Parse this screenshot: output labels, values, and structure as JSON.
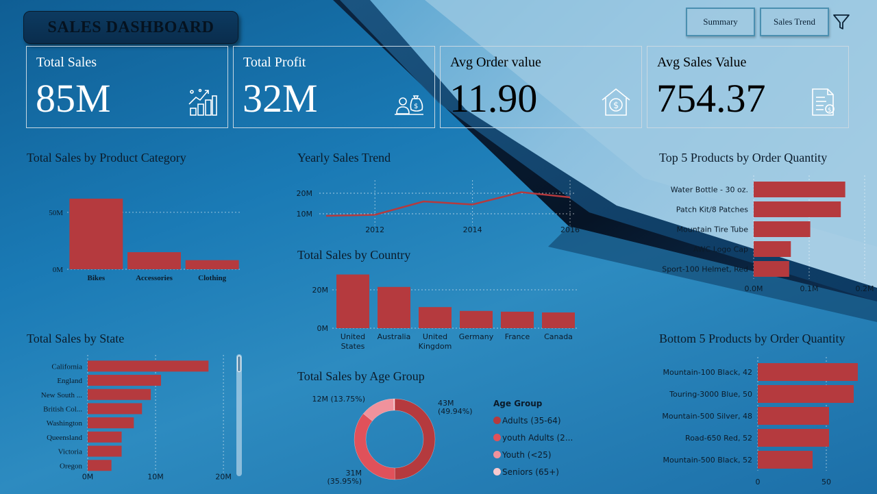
{
  "header": {
    "title": "SALES DASHBOARD",
    "nav": [
      {
        "label": "Summary"
      },
      {
        "label": "Sales Trend"
      }
    ],
    "filter_icon": "filter-icon"
  },
  "kpis": [
    {
      "label": "Total Sales",
      "value": "85M",
      "icon": "sales-growth-icon"
    },
    {
      "label": "Total Profit",
      "value": "32M",
      "icon": "profit-money-bag-icon"
    },
    {
      "label": "Avg Order value",
      "value": "11.90",
      "icon": "house-dollar-icon"
    },
    {
      "label": "Avg Sales Value",
      "value": "754.37",
      "icon": "invoice-icon"
    }
  ],
  "colors": {
    "bar": "#b53a3e",
    "accent_dark": "#0a2d4d",
    "donut": [
      "#b53a3e",
      "#e0515a",
      "#f0929c",
      "#f8c9cf"
    ]
  },
  "charts": {
    "category": {
      "title": "Total Sales by Product Category"
    },
    "yearly": {
      "title": "Yearly Sales Trend"
    },
    "country": {
      "title": "Total Sales by Country"
    },
    "state": {
      "title": "Total Sales by State"
    },
    "age": {
      "title": "Total Sales by Age Group",
      "legend_title": "Age Group"
    },
    "top5": {
      "title": "Top 5 Products by Order Quantity"
    },
    "bottom5": {
      "title": "Bottom 5 Products by Order Quantity"
    }
  },
  "chart_data": [
    {
      "id": "category",
      "type": "bar",
      "title": "Total Sales by Product Category",
      "categories": [
        "Bikes",
        "Accessories",
        "Clothing"
      ],
      "values": [
        62,
        15,
        8
      ],
      "ylim": [
        0,
        80
      ],
      "yticks": [
        {
          "v": 0,
          "label": "0M"
        },
        {
          "v": 50,
          "label": "50M"
        }
      ],
      "grid": true
    },
    {
      "id": "yearly",
      "type": "line",
      "title": "Yearly Sales Trend",
      "x": [
        2011,
        2012,
        2013,
        2014,
        2015,
        2016
      ],
      "values": [
        9,
        9.5,
        16,
        14.5,
        20.5,
        18
      ],
      "xticks": [
        {
          "v": 2012,
          "label": "2012"
        },
        {
          "v": 2014,
          "label": "2014"
        },
        {
          "v": 2016,
          "label": "2016"
        }
      ],
      "yticks": [
        {
          "v": 10,
          "label": "10M"
        },
        {
          "v": 20,
          "label": "20M"
        }
      ],
      "ylim": [
        5,
        25
      ],
      "grid": true
    },
    {
      "id": "country",
      "type": "bar",
      "title": "Total Sales by Country",
      "categories": [
        [
          "United",
          "States"
        ],
        [
          "Australia"
        ],
        [
          "United",
          "Kingdom"
        ],
        [
          "Germany"
        ],
        [
          "France"
        ],
        [
          "Canada"
        ]
      ],
      "values": [
        28,
        21.5,
        11,
        9,
        8.6,
        8.2
      ],
      "ylim": [
        0,
        30
      ],
      "yticks": [
        {
          "v": 0,
          "label": "0M"
        },
        {
          "v": 20,
          "label": "20M"
        }
      ],
      "grid": true
    },
    {
      "id": "state",
      "type": "bar",
      "orientation": "horizontal",
      "title": "Total Sales by State",
      "categories": [
        "California",
        "England",
        "New South ...",
        "British Col...",
        "Washington",
        "Queensland",
        "Victoria",
        "Oregon"
      ],
      "values": [
        17.8,
        10.8,
        9.3,
        8.0,
        6.8,
        5.0,
        5.0,
        3.5
      ],
      "xlim": [
        0,
        21
      ],
      "xticks": [
        {
          "v": 0,
          "label": "0M"
        },
        {
          "v": 10,
          "label": "10M"
        },
        {
          "v": 20,
          "label": "20M"
        }
      ],
      "grid": true
    },
    {
      "id": "age",
      "type": "pie",
      "title": "Total Sales by Age Group",
      "legend_title": "Age Group",
      "slices": [
        {
          "name": "Adults (35-64)",
          "value": 49.94,
          "label": [
            "43M",
            "(49.94%)"
          ]
        },
        {
          "name": "youth Adults (2...",
          "value": 35.95,
          "label": [
            "31M",
            "(35.95%)"
          ]
        },
        {
          "name": "Youth (<25)",
          "value": 13.75,
          "label": [
            "12M (13.75%)"
          ]
        },
        {
          "name": "Seniors (65+)",
          "value": 0.36,
          "label": []
        }
      ]
    },
    {
      "id": "top5",
      "type": "bar",
      "orientation": "horizontal",
      "title": "Top 5 Products by Order Quantity",
      "categories": [
        "Water Bottle - 30 oz.",
        "Patch Kit/8 Patches",
        "Mountain Tire Tube",
        "AWC Logo Cap",
        "Sport-100 Helmet, Red"
      ],
      "values": [
        0.165,
        0.157,
        0.102,
        0.067,
        0.064
      ],
      "xlim": [
        0,
        0.2
      ],
      "xticks": [
        {
          "v": 0,
          "label": "0.0M"
        },
        {
          "v": 0.1,
          "label": "0.1M"
        },
        {
          "v": 0.2,
          "label": "0.2M"
        }
      ],
      "grid": true
    },
    {
      "id": "bottom5",
      "type": "bar",
      "orientation": "horizontal",
      "title": "Bottom 5 Products by Order Quantity",
      "categories": [
        "Mountain-100 Black, 42",
        "Touring-3000 Blue, 50",
        "Mountain-500 Silver, 48",
        "Road-650 Red, 52",
        "Mountain-500 Black, 52"
      ],
      "values": [
        73,
        70,
        52,
        52,
        40
      ],
      "xlim": [
        0,
        74
      ],
      "xticks": [
        {
          "v": 0,
          "label": "0"
        },
        {
          "v": 50,
          "label": "50"
        }
      ],
      "grid": true
    }
  ]
}
